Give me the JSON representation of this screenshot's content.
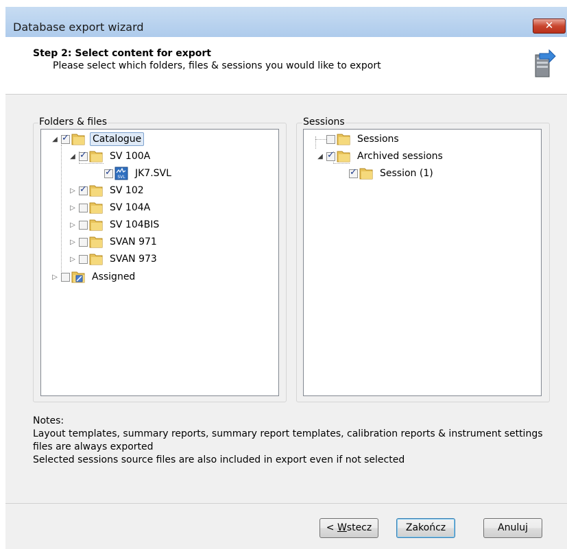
{
  "window": {
    "title": "Database export wizard",
    "close_label": "✕"
  },
  "header": {
    "step_title": "Step 2: Select content for export",
    "step_description": "Please select which folders, files & sessions you would like to export"
  },
  "folders": {
    "label": "Folders & files",
    "items": [
      {
        "label": "Catalogue",
        "checked": true,
        "expanded": true,
        "selected": true
      },
      {
        "label": "SV 100A",
        "checked": true,
        "expanded": true
      },
      {
        "label": "JK7.SVL",
        "checked": true
      },
      {
        "label": "SV 102",
        "checked": true,
        "expanded": false
      },
      {
        "label": "SV 104A",
        "checked": false,
        "expanded": false
      },
      {
        "label": "SV 104BIS",
        "checked": false,
        "expanded": false
      },
      {
        "label": "SVAN 971",
        "checked": false,
        "expanded": false
      },
      {
        "label": "SVAN 973",
        "checked": false,
        "expanded": false
      },
      {
        "label": "Assigned",
        "checked": false,
        "expanded": false
      }
    ]
  },
  "sessions": {
    "label": "Sessions",
    "items": [
      {
        "label": "Sessions",
        "checked": false
      },
      {
        "label": "Archived sessions",
        "checked": true,
        "expanded": true
      },
      {
        "label": "Session (1)",
        "checked": true
      }
    ]
  },
  "notes": {
    "heading": "Notes:",
    "line1": "Layout templates, summary reports, summary report templates, calibration reports & instrument settings files are always exported",
    "line2": "Selected sessions source files are also included in export even if not selected"
  },
  "buttons": {
    "back_prefix": "< ",
    "back_mnemonic": "W",
    "back_rest": "stecz",
    "finish": "Zakończ",
    "cancel": "Anuluj"
  },
  "icons": {
    "folder": "folder-icon",
    "file": "svl-file-icon",
    "assigned": "assigned-folder-icon",
    "export": "database-export-icon"
  }
}
